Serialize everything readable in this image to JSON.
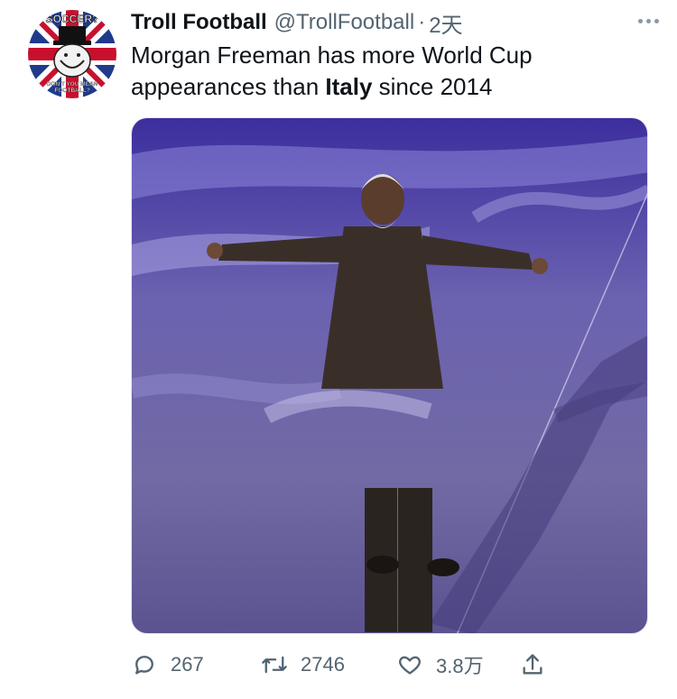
{
  "tweet": {
    "author_name": "Troll Football",
    "handle": "@TrollFootball",
    "separator": "·",
    "time": "2天",
    "text_part1": "Morgan Freeman has more World Cup appearances than ",
    "text_bold": "Italy",
    "text_part2": " since 2014"
  },
  "avatar": {
    "top_text": "SOCCER?",
    "bottom_line1": "DON'T YOU MEAN",
    "bottom_line2": "FOOTBALL?"
  },
  "actions": {
    "replies": "267",
    "retweets": "2746",
    "likes": "3.8万"
  },
  "icons": {
    "more": "more-horizontal-icon",
    "reply": "reply-icon",
    "retweet": "retweet-icon",
    "like": "heart-icon",
    "share": "share-icon"
  },
  "colors": {
    "text_primary": "#0f1419",
    "text_secondary": "#536471",
    "media_bg": "#5e5796"
  }
}
